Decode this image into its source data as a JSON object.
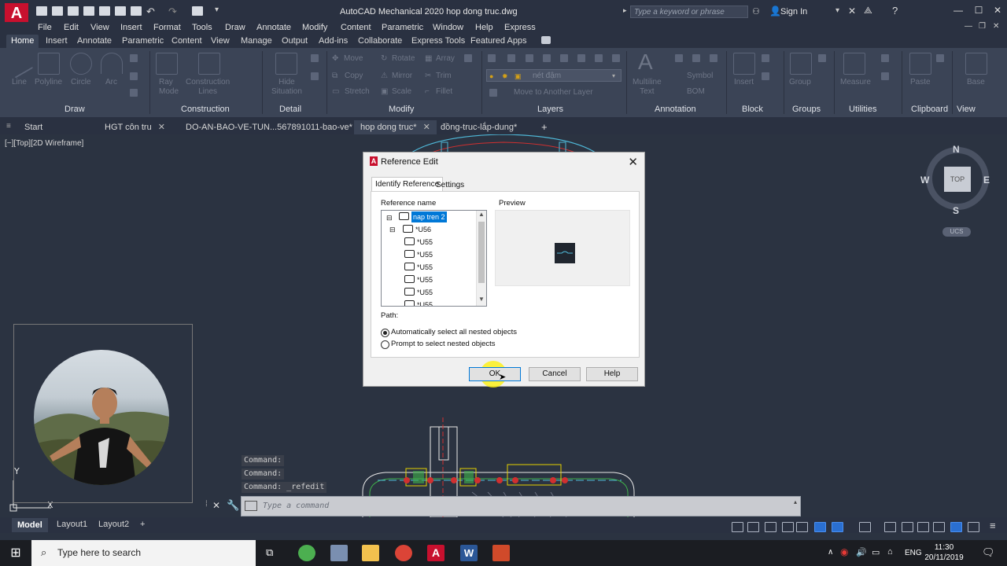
{
  "titlebar": {
    "title": "AutoCAD Mechanical 2020   hop dong truc.dwg",
    "search_placeholder": "Type a keyword or phrase",
    "sign_in": "Sign In"
  },
  "menu": [
    "File",
    "Edit",
    "View",
    "Insert",
    "Format",
    "Tools",
    "Draw",
    "Annotate",
    "Modify",
    "Content",
    "Parametric",
    "Window",
    "Help",
    "Express"
  ],
  "ribbon_tabs": [
    "Home",
    "Insert",
    "Annotate",
    "Parametric",
    "Content",
    "View",
    "Manage",
    "Output",
    "Add-ins",
    "Collaborate",
    "Express Tools",
    "Featured Apps"
  ],
  "ribbon": {
    "panels": [
      "Draw",
      "Construction",
      "Detail",
      "Modify",
      "Layers",
      "Annotation",
      "Block",
      "Groups",
      "Utilities",
      "Clipboard",
      "View"
    ],
    "labels": {
      "line": "Line",
      "polyline": "Polyline",
      "circle": "Circle",
      "arc": "Arc",
      "ray_mode": "Ray\nMode",
      "construction_lines": "Construction\nLines",
      "hide_situation": "Hide\nSituation",
      "move": "Move",
      "rotate": "Rotate",
      "array": "Array",
      "copy": "Copy",
      "mirror": "Mirror",
      "trim": "Trim",
      "stretch": "Stretch",
      "scale": "Scale",
      "fillet": "Fillet",
      "move_layer": "Move to Another Layer",
      "multiline_text": "Multiline\nText",
      "symbol": "Symbol",
      "bom": "BOM",
      "insert": "Insert",
      "group": "Group",
      "measure": "Measure",
      "paste": "Paste",
      "base": "Base"
    },
    "layer_value": "nét đậm"
  },
  "doc_tabs": [
    {
      "label": "Start",
      "active": false,
      "closable": false
    },
    {
      "label": "HGT côn tru",
      "active": false,
      "closable": true
    },
    {
      "label": "DO-AN-BAO-VE-TUN...567891011-bao-ve*",
      "active": false,
      "closable": true
    },
    {
      "label": "hop dong truc*",
      "active": true,
      "closable": true
    },
    {
      "label": "đồng-truc-lắp-dung*",
      "active": false,
      "closable": false
    }
  ],
  "viewport_label": "[−][Top][2D Wireframe]",
  "viewcube": {
    "top": "TOP",
    "n": "N",
    "s": "S",
    "e": "E",
    "w": "W",
    "ucs": "UCS"
  },
  "command": {
    "history": [
      "Command:",
      "Command:",
      "Command: _refedit"
    ],
    "placeholder": "Type a command"
  },
  "layout_tabs": [
    "Model",
    "Layout1",
    "Layout2"
  ],
  "dialog": {
    "title": "Reference Edit",
    "tabs": [
      "Identify Reference",
      "Settings"
    ],
    "reference_name_label": "Reference name",
    "preview_label": "Preview",
    "tree": [
      {
        "label": "nap tren 2",
        "selected": true,
        "level": 0
      },
      {
        "label": "*U56",
        "selected": false,
        "level": 1
      },
      {
        "label": "*U55",
        "selected": false,
        "level": 2
      },
      {
        "label": "*U55",
        "selected": false,
        "level": 2
      },
      {
        "label": "*U55",
        "selected": false,
        "level": 2
      },
      {
        "label": "*U55",
        "selected": false,
        "level": 2
      },
      {
        "label": "*U55",
        "selected": false,
        "level": 2
      },
      {
        "label": "*U55",
        "selected": false,
        "level": 2
      }
    ],
    "path_label": "Path:",
    "radio_auto": "Automatically select all nested objects",
    "radio_prompt": "Prompt to select nested objects",
    "ok": "OK",
    "cancel": "Cancel",
    "help": "Help"
  },
  "taskbar": {
    "search_placeholder": "Type here to search",
    "language": "ENG",
    "time": "11:30",
    "date": "20/11/2019"
  },
  "icons": [
    "new-icon",
    "open-icon",
    "save-icon",
    "saveas-icon",
    "print-icon",
    "undo-icon",
    "redo-icon",
    "search-icon",
    "signin-icon",
    "help-icon"
  ]
}
